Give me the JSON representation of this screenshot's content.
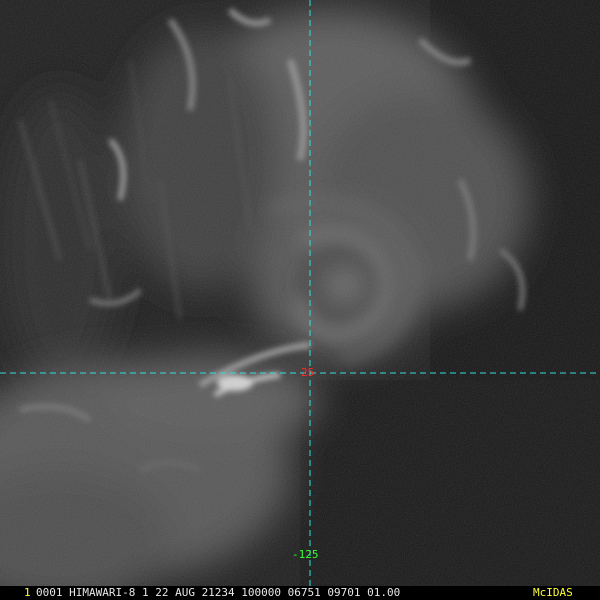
{
  "overlay": {
    "latitude_label": "25",
    "longitude_label": "-125",
    "crosshair_color": "#33dddd",
    "latitude_color": "#ff2a2a",
    "longitude_color": "#33ff33"
  },
  "status_bar": {
    "frame_number": "1",
    "text": "0001 HIMAWARI-8   1 22 AUG 21234 100000 06751 09701 01.00",
    "brand": "McIDAS",
    "text_color": "#e8e8e8",
    "accent_color": "#ffff33"
  }
}
